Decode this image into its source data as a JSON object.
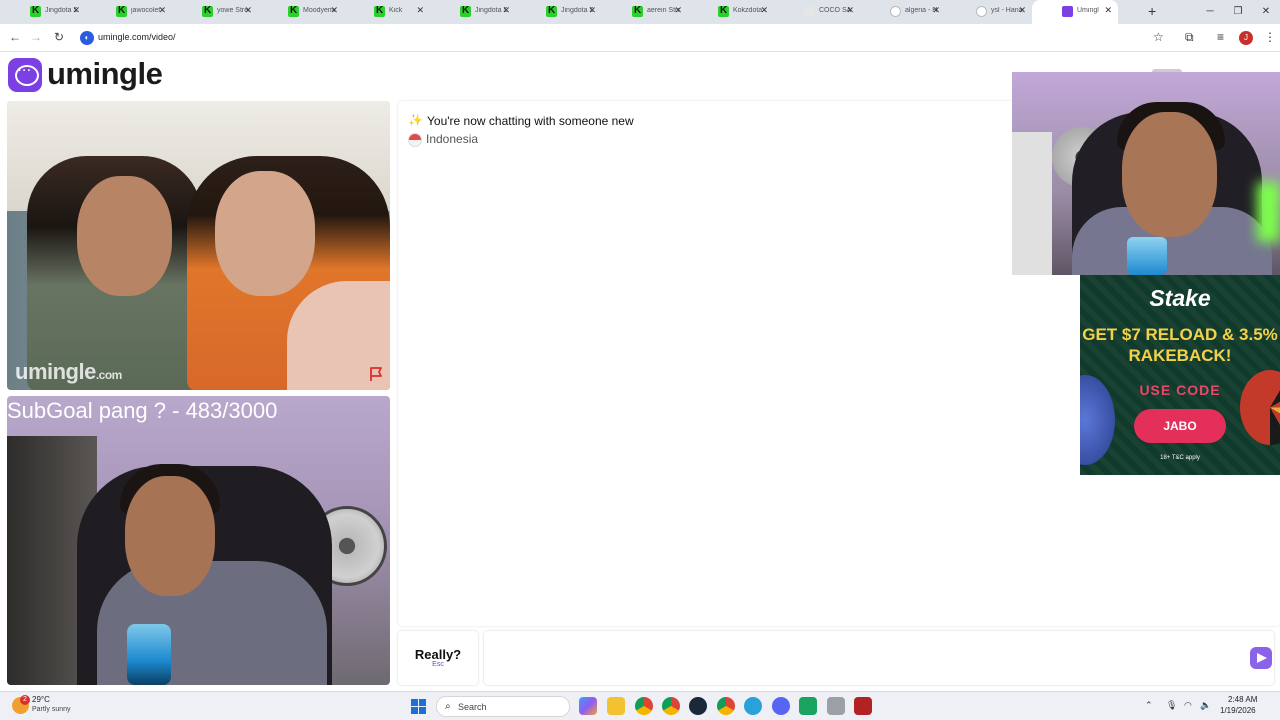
{
  "browser": {
    "tabs": [
      {
        "title": "Jingdota Str",
        "icon": "kick-icon"
      },
      {
        "title": "jawocolet St",
        "icon": "kick-icon"
      },
      {
        "title": "yowe Stream",
        "icon": "kick-icon"
      },
      {
        "title": "Moodyemel",
        "icon": "kick-icon"
      },
      {
        "title": "Kick",
        "icon": "kick-icon"
      },
      {
        "title": "Jingdota Str",
        "icon": "kick-icon"
      },
      {
        "title": "Jingdota Str",
        "icon": "kick-icon"
      },
      {
        "title": "aerein Strea",
        "icon": "kick-icon"
      },
      {
        "title": "Kokzdota St",
        "icon": "kick-icon"
      },
      {
        "title": "COCO SAMI",
        "icon": "coco-icon"
      },
      {
        "title": "algeria - Ha",
        "icon": "google-icon"
      },
      {
        "title": "ysl - Hanapi",
        "icon": "google-icon"
      },
      {
        "title": "Umingl",
        "icon": "umingle-icon",
        "active": true
      }
    ],
    "url": "umingle.com/video/",
    "profile_initial": "J"
  },
  "site": {
    "logo_text": "umingle",
    "brand_color": "#7b3fe4"
  },
  "remote_video": {
    "watermark_main": "umingle",
    "watermark_suffix": ".com"
  },
  "self_video": {
    "overlay_text": "SubGoal pang ? - 483/3000"
  },
  "chat": {
    "status_message": "You're now chatting with someone new",
    "country": "Indonesia"
  },
  "controls": {
    "esc_label": "Really?",
    "esc_key": "Esc",
    "input_value": "",
    "input_placeholder": ""
  },
  "ad": {
    "brand": "Stake",
    "headline": "GET $7 RELOAD & 3.5% RAKEBACK!",
    "use_code_label": "USE CODE",
    "code": "JABO",
    "terms": "18+ T&C apply"
  },
  "taskbar": {
    "weather_temp": "29°C",
    "weather_condition": "Partly sunny",
    "weather_badge": "2",
    "search_label": "Search",
    "time": "2:48 AM",
    "date": "1/19/2026"
  }
}
